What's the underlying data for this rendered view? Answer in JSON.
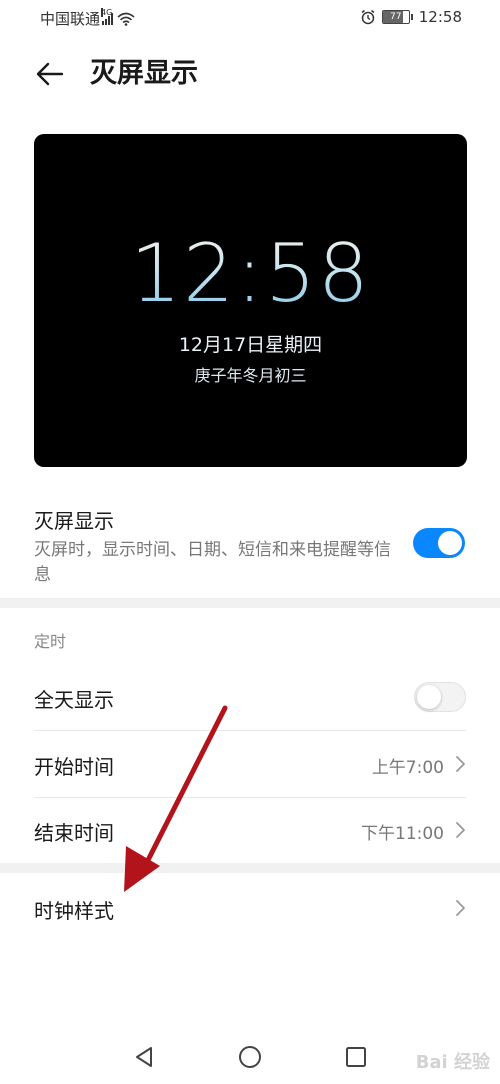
{
  "status_bar": {
    "carrier": "中国联通",
    "network": "4G",
    "battery": "77",
    "battery_level": 0.77,
    "time": "12:58"
  },
  "header": {
    "back_icon": "back-arrow-icon",
    "title": "灭屏显示"
  },
  "preview": {
    "time": "12:58",
    "date": "12月17日星期四",
    "lunar": "庚子年冬月初三"
  },
  "aod": {
    "title": "灭屏显示",
    "description": "灭屏时，显示时间、日期、短信和来电提醒等信息",
    "enabled": true
  },
  "schedule": {
    "section_label": "定时",
    "all_day": {
      "label": "全天显示",
      "enabled": false
    },
    "start_time": {
      "label": "开始时间",
      "value": "上午7:00"
    },
    "end_time": {
      "label": "结束时间",
      "value": "下午11:00"
    }
  },
  "clock_style": {
    "label": "时钟样式"
  },
  "nav": {
    "back_icon": "triangle-back-icon",
    "home_icon": "circle-home-icon",
    "recent_icon": "square-recent-icon"
  },
  "watermark": "Bai 经验",
  "colors": {
    "accent": "#0a87ff",
    "annotation_arrow": "#b3131b"
  }
}
